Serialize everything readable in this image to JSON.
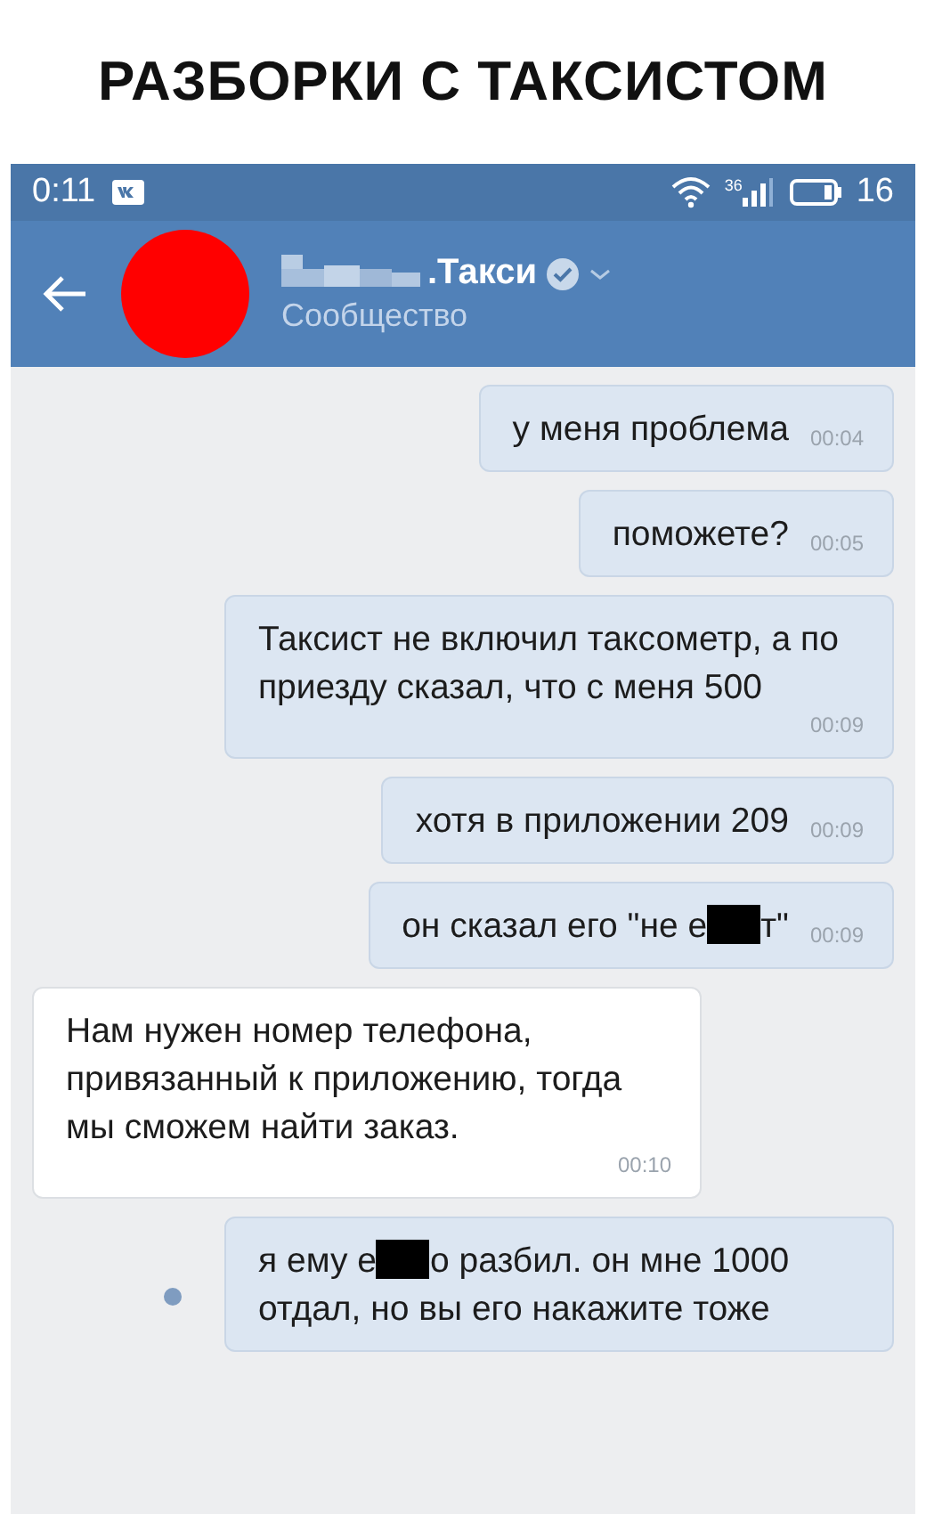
{
  "caption": "РАЗБОРКИ С ТАКСИСТОМ",
  "status_bar": {
    "time": "0:11",
    "network": "36",
    "battery": "16"
  },
  "header": {
    "name": ".Такси",
    "verified": true,
    "subtitle": "Сообщество"
  },
  "messages": [
    {
      "kind": "out",
      "parts": [
        {
          "kind": "text",
          "text": "у меня проблема"
        }
      ],
      "time": "00:04",
      "unread": false
    },
    {
      "kind": "out",
      "parts": [
        {
          "kind": "text",
          "text": "поможете?"
        }
      ],
      "time": "00:05",
      "unread": false
    },
    {
      "kind": "out",
      "parts": [
        {
          "kind": "text",
          "text": "Таксист не включил таксометр, а по приезду сказал, что с меня 500"
        }
      ],
      "time": "00:09",
      "unread": false
    },
    {
      "kind": "out",
      "parts": [
        {
          "kind": "text",
          "text": "хотя в приложении 209"
        }
      ],
      "time": "00:09",
      "unread": false
    },
    {
      "kind": "out",
      "parts": [
        {
          "kind": "text",
          "text": "он сказал его \"не е"
        },
        {
          "kind": "redacted"
        },
        {
          "kind": "text",
          "text": "т\""
        }
      ],
      "time": "00:09",
      "unread": false
    },
    {
      "kind": "in",
      "parts": [
        {
          "kind": "text",
          "text": "Нам нужен номер телефона, привязанный к приложению, тогда мы сможем найти заказ."
        }
      ],
      "time": "00:10",
      "unread": false
    },
    {
      "kind": "out",
      "parts": [
        {
          "kind": "text",
          "text": "я ему е"
        },
        {
          "kind": "redacted"
        },
        {
          "kind": "text",
          "text": "о разбил. он мне 1000 отдал, но вы его накажите тоже"
        }
      ],
      "unread": true
    }
  ]
}
